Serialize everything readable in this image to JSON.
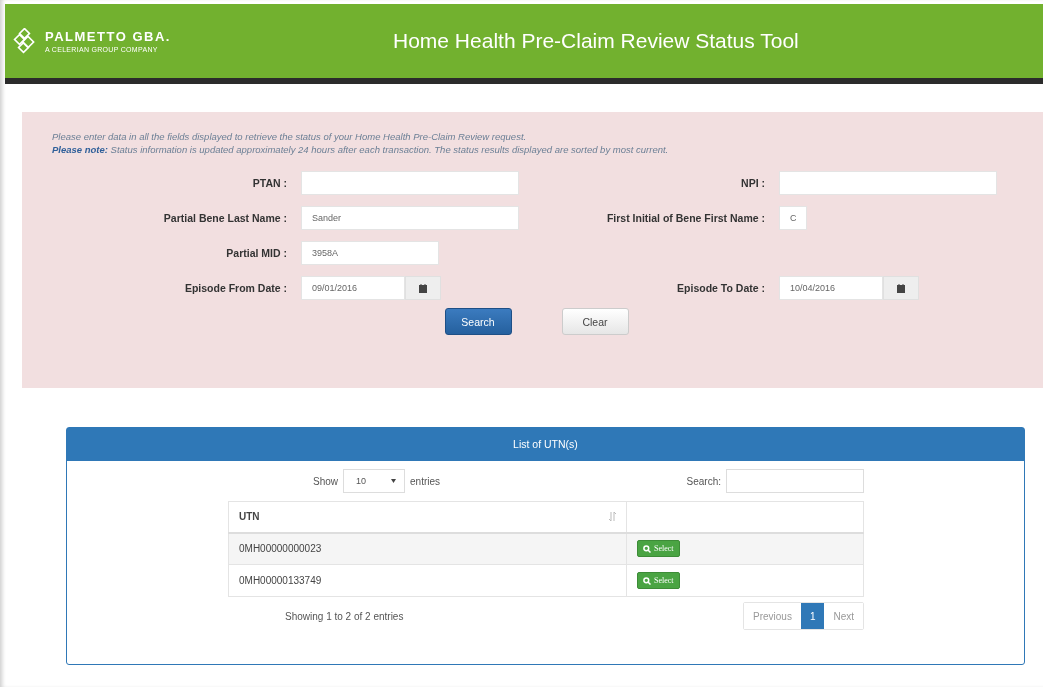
{
  "header": {
    "logo_name": "PALMETTO GBA.",
    "logo_tagline": "A CELERIAN GROUP COMPANY",
    "title": "Home Health Pre-Claim Review Status Tool"
  },
  "form": {
    "instruction": "Please enter data in all the fields displayed to retrieve the status of your Home Health Pre-Claim Review request.",
    "note": "**Please note:** Status information is updated approximately 24 hours after each transaction. The status results displayed are sorted by most current.",
    "rows": [
      {
        "left": {
          "label": "PTAN :",
          "kind": "wide"
        },
        "right": {
          "label": "NPI :",
          "kind": "wide"
        }
      },
      {
        "left": {
          "label": "Partial Bene Last Name :",
          "kind": "wide",
          "value": "Sander"
        },
        "right": {
          "label": "First Initial of Bene First Name :",
          "kind": "initial",
          "value": "C"
        }
      },
      {
        "left": {
          "label": "Partial MID :",
          "kind": "medium",
          "value": "3958A"
        }
      },
      {
        "left": {
          "label": "Episode From Date :",
          "kind": "date",
          "value": "09/01/2016"
        },
        "right": {
          "label": "Episode To Date :",
          "kind": "date",
          "value": "10/04/2016"
        }
      }
    ],
    "buttons": [
      {
        "label": "Search",
        "kind": "primary"
      },
      {
        "label": "Clear",
        "kind": "default"
      }
    ]
  },
  "utn_panel": {
    "title": "List of UTN(s)",
    "show_label": "Show",
    "page_size": "10",
    "entries_label": "entries",
    "search_label": "Search:",
    "columns": [
      "UTN"
    ],
    "rows": [
      {
        "utn": "0MH00000000023",
        "action": "Select"
      },
      {
        "utn": "0MH00000133749",
        "action": "Select"
      }
    ],
    "info": "Showing 1 to 2 of 2 entries",
    "pagination": [
      {
        "label": "Previous",
        "selected": false
      },
      {
        "label": "1",
        "selected": true
      },
      {
        "label": "Next",
        "selected": false
      }
    ]
  }
}
